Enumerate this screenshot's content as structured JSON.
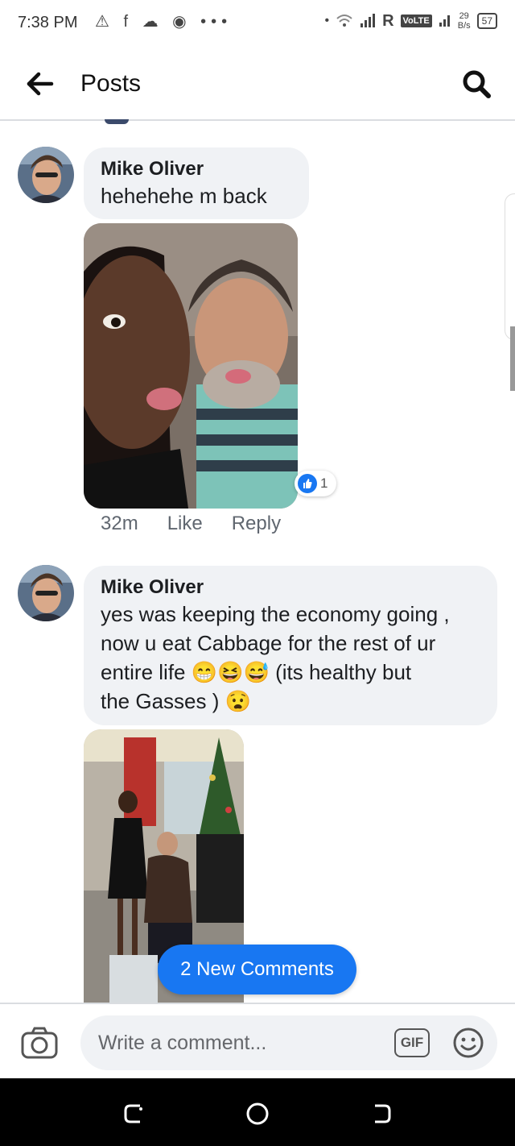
{
  "status_bar": {
    "time": "7:38 PM",
    "left_icons": "⚠ f ☁ ◉ •••",
    "carrier_r": "R",
    "volte": "VoLTE",
    "speed_value": "29",
    "speed_unit": "B/s",
    "battery": "57"
  },
  "header": {
    "title": "Posts"
  },
  "comments": [
    {
      "author": "Mike Oliver",
      "text": "hehehehe m back",
      "time": "32m",
      "like_label": "Like",
      "reply_label": "Reply",
      "reaction_count": "1"
    },
    {
      "author": "Mike Oliver",
      "text_lines": [
        "yes was keeping the economy going ,",
        "now u eat Cabbage for the rest of ur",
        "entire life 😁😆😅  (its healthy but",
        "the Gasses ) 😧"
      ]
    }
  ],
  "new_comments_label": "2 New Comments",
  "composer": {
    "placeholder": "Write a comment...",
    "gif_label": "GIF"
  },
  "colors": {
    "accent": "#1877f2",
    "bubble": "#f0f2f5",
    "meta_text": "#606770"
  }
}
